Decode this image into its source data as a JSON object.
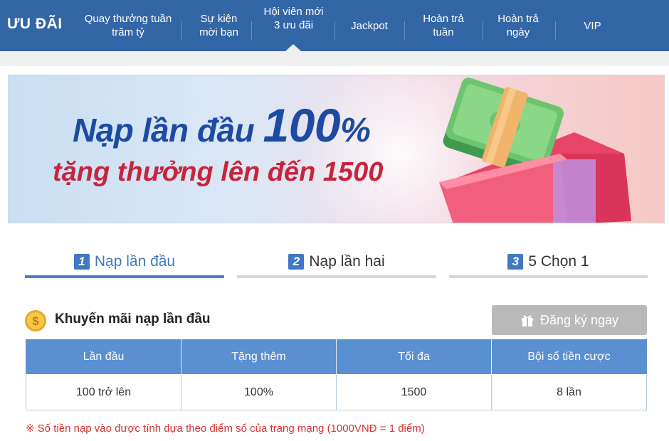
{
  "brand": "ƯU ĐÃI",
  "nav": {
    "items": [
      {
        "line1": "Quay thưởng tuần",
        "line2": "trăm tỷ"
      },
      {
        "line1": "Sự kiện",
        "line2": "mời bạn"
      },
      {
        "line1": "Hội viên mới",
        "line2": "3 ưu đãi",
        "active": true
      },
      {
        "line1": "Jackpot",
        "line2": ""
      },
      {
        "line1": "Hoàn trả",
        "line2": "tuần"
      },
      {
        "line1": "Hoàn trả",
        "line2": "ngày"
      },
      {
        "line1": "VIP",
        "line2": ""
      }
    ]
  },
  "banner": {
    "line1_text": "Nạp lần đầu ",
    "line1_number": "100",
    "line1_percent": "%",
    "line2": "tặng thưởng lên đến 1500"
  },
  "tabs": [
    {
      "num": "1",
      "label": "Nạp lần đầu",
      "active": true
    },
    {
      "num": "2",
      "label": "Nạp lần hai",
      "active": false
    },
    {
      "num": "3",
      "label": "5 Chọn 1",
      "active": false
    }
  ],
  "section": {
    "title": "Khuyến mãi nạp lần đầu",
    "register_label": "Đăng ký ngay",
    "coin_icon": "dollar-coin-icon",
    "gift_icon": "gift-icon"
  },
  "table": {
    "headers": [
      "Lần đầu",
      "Tặng thêm",
      "Tối đa",
      "Bội số tiền cược"
    ],
    "row": [
      "100 trở lên",
      "100%",
      "1500",
      "8 lần"
    ]
  },
  "note": "※ Số tiền nạp vào được tính dựa theo điểm số của trang mạng (1000VNĐ = 1 điểm)",
  "colors": {
    "nav_bg": "#3366a6",
    "accent_blue": "#3f78c4",
    "table_header": "#5a8fd1",
    "note_red": "#d93030",
    "button_gray": "#b9b9b9"
  }
}
